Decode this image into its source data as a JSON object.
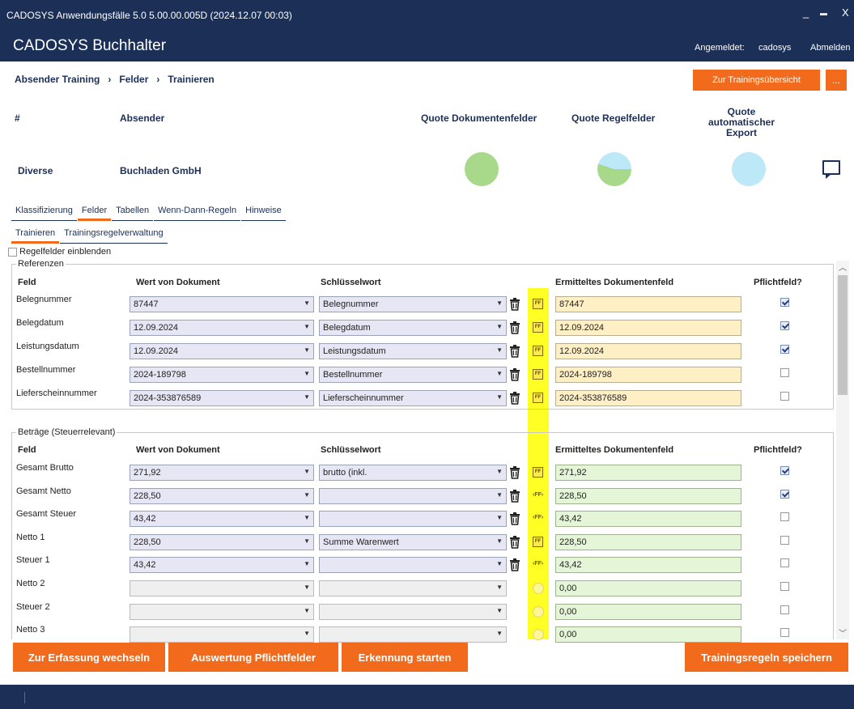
{
  "window": {
    "title": "CADOSYS Anwendungsfälle 5.0 5.00.00.005D (2024.12.07 00:03)",
    "minimize": "_",
    "maximize": "▬",
    "close": "X"
  },
  "app": {
    "title": "CADOSYS Buchhalter",
    "login_label": "Angemeldet:",
    "user": "cadosys",
    "logout": "Abmelden"
  },
  "breadcrumb": [
    "Absender Training",
    "Felder",
    "Trainieren"
  ],
  "breadcrumb_sep": "›",
  "buttons": {
    "to_overview": "Zur Trainingsübersicht",
    "more": "..."
  },
  "summary": {
    "headers": {
      "hash": "#",
      "sender": "Absender",
      "quota_doc": "Quote Dokumentenfelder",
      "quota_rule": "Quote Regelfelder",
      "quota_export": "Quote automatischer Export"
    },
    "row": {
      "id": "Diverse",
      "sender": "Buchladen GmbH"
    },
    "pies": [
      {
        "name": "quota-doc",
        "fill_fraction": 1.0,
        "color": "#a8d88a"
      },
      {
        "name": "quota-rule",
        "fill_fraction": 0.55,
        "color": "#a8d88a",
        "rest_color": "#bde8f7"
      },
      {
        "name": "quota-export",
        "fill_fraction": 0.0,
        "color": "#bde8f7"
      }
    ]
  },
  "tabs_main": [
    "Klassifizierung",
    "Felder",
    "Tabellen",
    "Wenn-Dann-Regeln",
    "Hinweise"
  ],
  "tabs_sub": [
    "Trainieren",
    "Trainingsregelverwaltung"
  ],
  "show_rule_fields": "Regelfelder einblenden",
  "columns": {
    "field": "Feld",
    "doc_value": "Wert von Dokument",
    "keyword": "Schlüsselwort",
    "result": "Ermitteltes Dokumentenfeld",
    "mandatory": "Pflichtfeld?"
  },
  "references": {
    "label": "Referenzen",
    "rows": [
      {
        "field": "Belegnummer",
        "value": "87447",
        "keyword": "Belegnummer",
        "result": "87447",
        "mandatory": true
      },
      {
        "field": "Belegdatum",
        "value": "12.09.2024",
        "keyword": "Belegdatum",
        "result": "12.09.2024",
        "mandatory": true
      },
      {
        "field": "Leistungsdatum",
        "value": "12.09.2024",
        "keyword": "Leistungsdatum",
        "result": "12.09.2024",
        "mandatory": true
      },
      {
        "field": "Bestellnummer",
        "value": "2024-189798",
        "keyword": "Bestellnummer",
        "result": "2024-189798",
        "mandatory": false
      },
      {
        "field": "Lieferscheinnummer",
        "value": "2024-353876589",
        "keyword": "Lieferscheinnummer",
        "result": "2024-353876589",
        "mandatory": false
      }
    ]
  },
  "amounts": {
    "label": "Beträge (Steuerrelevant)",
    "rows": [
      {
        "field": "Gesamt Brutto",
        "value": "271,92",
        "keyword": "brutto (inkl.",
        "result": "271,92",
        "mandatory": true
      },
      {
        "field": "Gesamt Netto",
        "value": "228,50",
        "keyword": "",
        "result": "228,50",
        "mandatory": true
      },
      {
        "field": "Gesamt Steuer",
        "value": "43,42",
        "keyword": "",
        "result": "43,42",
        "mandatory": false
      },
      {
        "field": "Netto 1",
        "value": "228,50",
        "keyword": "Summe Warenwert",
        "result": "228,50",
        "mandatory": false
      },
      {
        "field": "Steuer 1",
        "value": "43,42",
        "keyword": "",
        "result": "43,42",
        "mandatory": false
      },
      {
        "field": "Netto 2",
        "value": "",
        "keyword": "",
        "result": "0,00",
        "mandatory": false
      },
      {
        "field": "Steuer 2",
        "value": "",
        "keyword": "",
        "result": "0,00",
        "mandatory": false
      },
      {
        "field": "Netto 3",
        "value": "",
        "keyword": "",
        "result": "0,00",
        "mandatory": false
      }
    ]
  },
  "icon_labels": {
    "ff": "FF",
    "ffp": "‹FF›"
  },
  "bottom_buttons": {
    "to_capture": "Zur Erfassung wechseln",
    "evaluate": "Auswertung Pflichtfelder",
    "recognize": "Erkennung starten",
    "save": "Trainingsregeln speichern"
  }
}
